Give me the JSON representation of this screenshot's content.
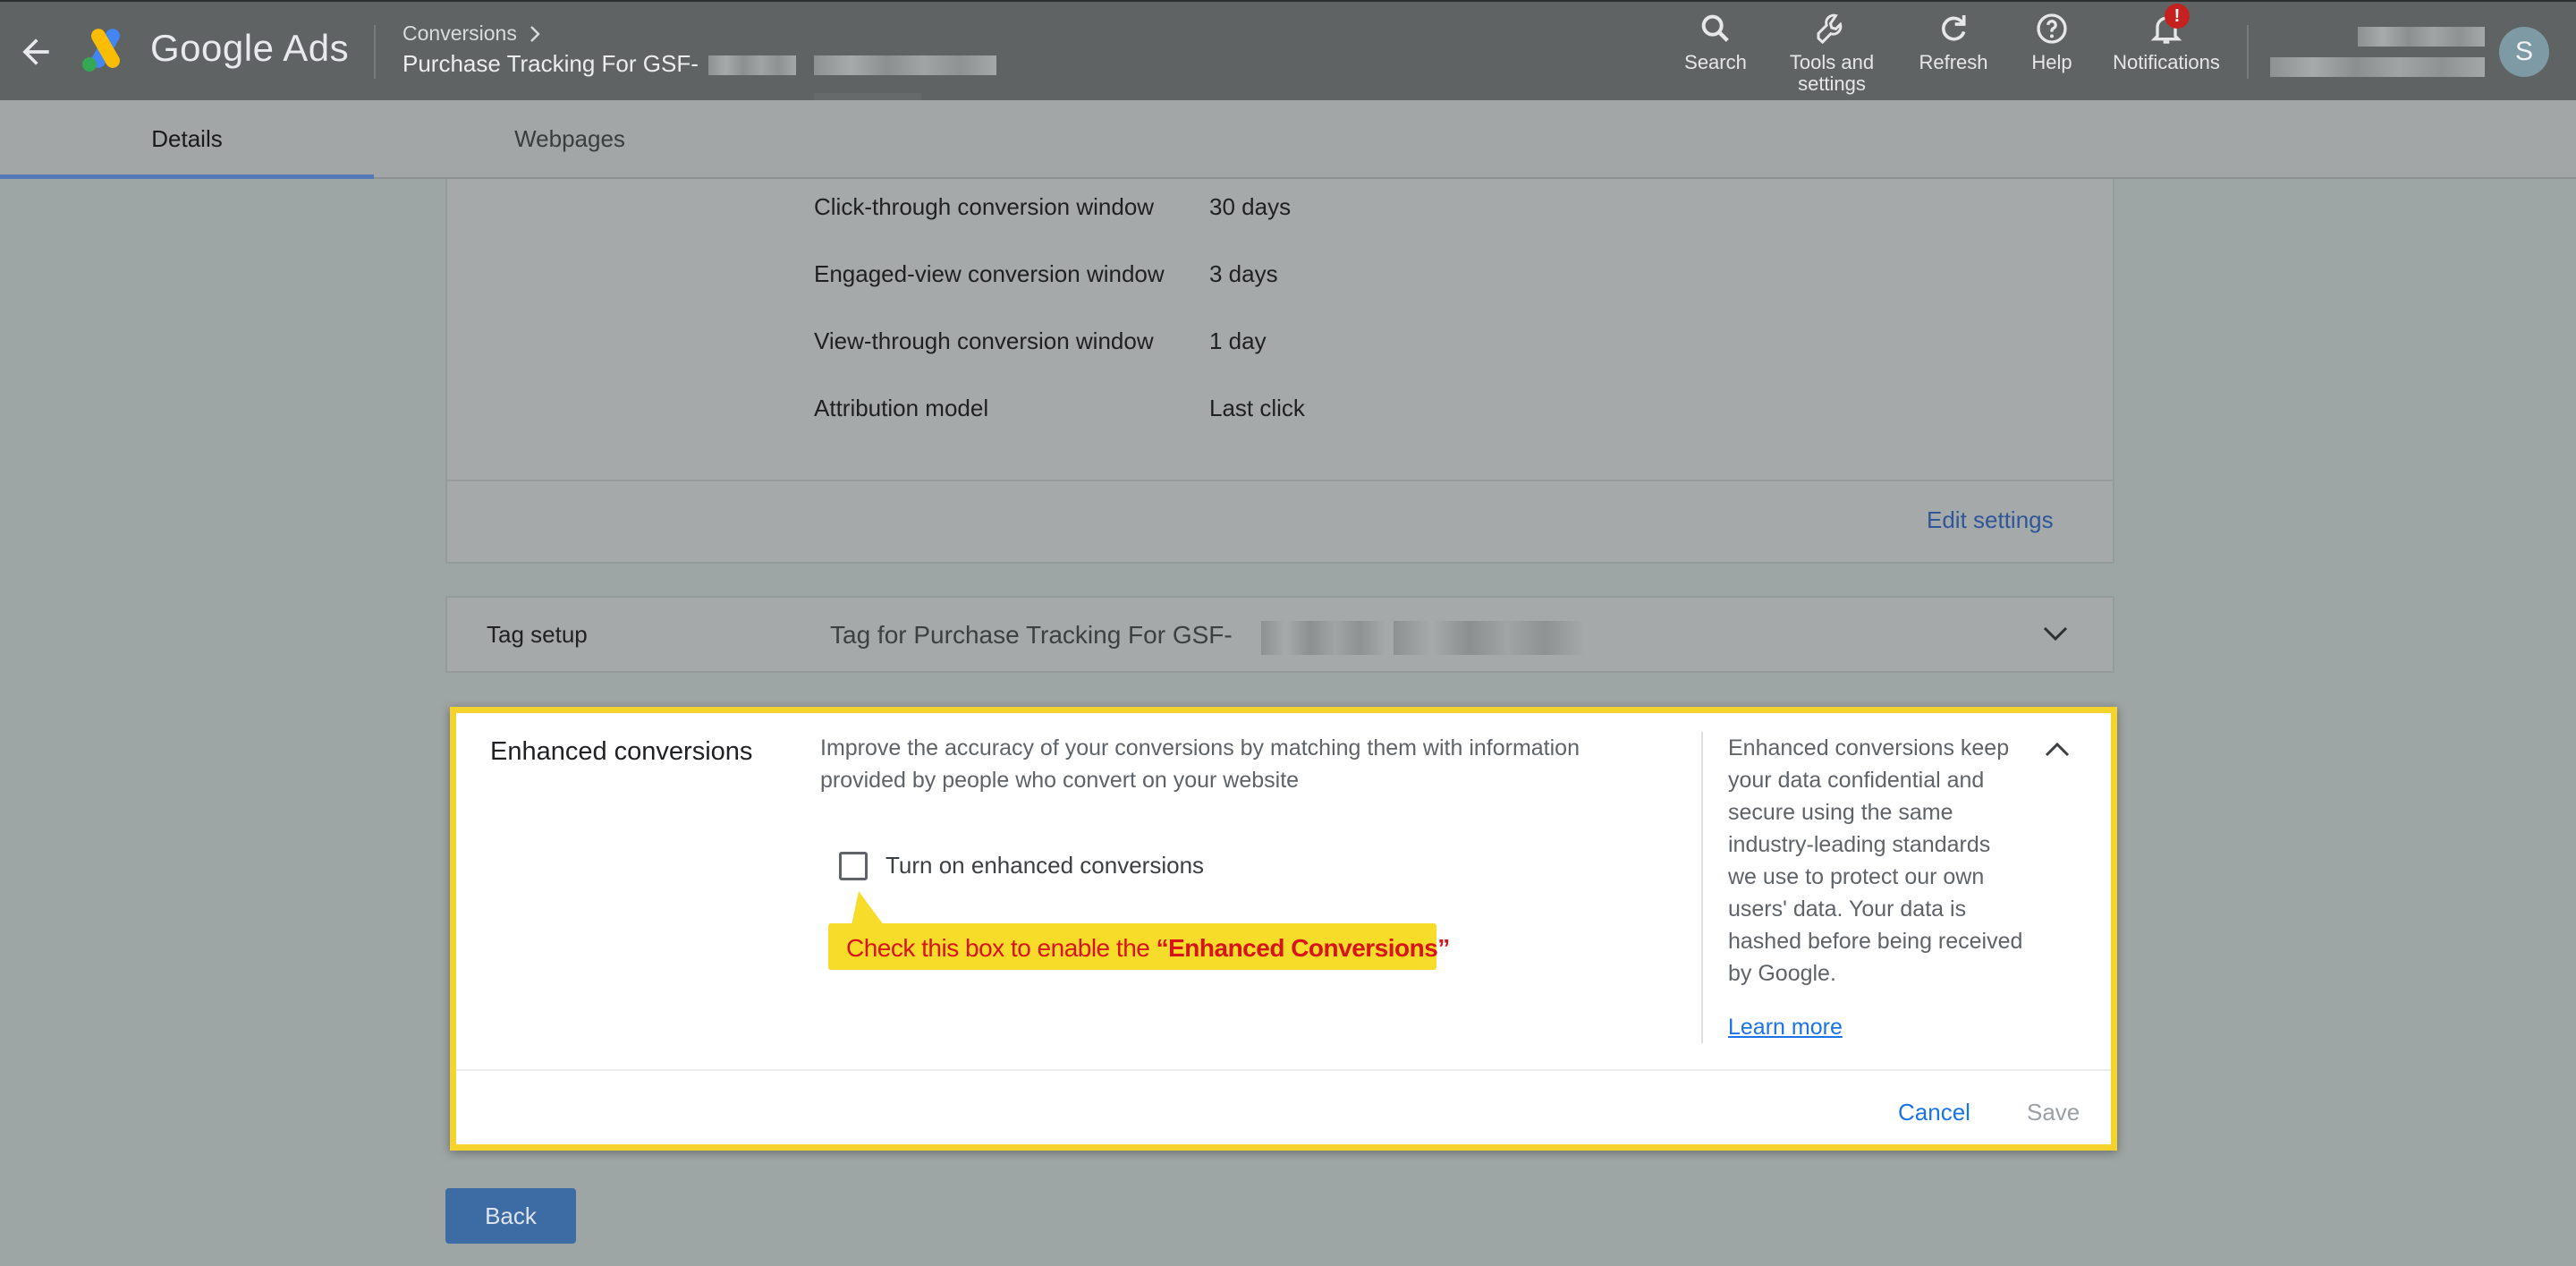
{
  "header": {
    "brand": "Google Ads",
    "breadcrumb": "Conversions",
    "title": "Purchase Tracking For GSF-",
    "tools": [
      {
        "icon": "search-icon",
        "label": "Search"
      },
      {
        "icon": "wrench-icon",
        "label": "Tools and settings"
      },
      {
        "icon": "refresh-icon",
        "label": "Refresh"
      },
      {
        "icon": "help-icon",
        "label": "Help"
      },
      {
        "icon": "bell-icon",
        "label": "Notifications"
      }
    ],
    "notification_badge": "!",
    "avatar_initial": "S"
  },
  "tabs": [
    {
      "label": "Details",
      "active": true
    },
    {
      "label": "Webpages",
      "active": false
    }
  ],
  "settings": {
    "rows": [
      {
        "label": "Click-through conversion window",
        "value": "30 days"
      },
      {
        "label": "Engaged-view conversion window",
        "value": "3 days"
      },
      {
        "label": "View-through conversion window",
        "value": "1 day"
      },
      {
        "label": "Attribution model",
        "value": "Last click"
      }
    ],
    "edit_link": "Edit settings"
  },
  "tag_setup": {
    "label": "Tag setup",
    "value": "Tag for Purchase Tracking For GSF-"
  },
  "enhanced": {
    "title": "Enhanced conversions",
    "description": "Improve the accuracy of your conversions by matching them with information provided by people who convert on your website",
    "checkbox_label": "Turn on enhanced conversions",
    "checked": false,
    "callout_prefix": "Check this box to enable the ",
    "callout_emphasis": "“Enhanced Conversions”",
    "side_text": "Enhanced conversions keep your data confidential and secure using the same industry-leading standards we use to protect our own users' data. Your data is hashed before being received by Google.",
    "learn_more": "Learn more",
    "cancel": "Cancel",
    "save": "Save"
  },
  "back_button": "Back",
  "colors": {
    "header_bg": "#5f6363",
    "highlight": "#f5d32c",
    "link_blue": "#1a73e8",
    "callout_text": "#d8141a"
  }
}
